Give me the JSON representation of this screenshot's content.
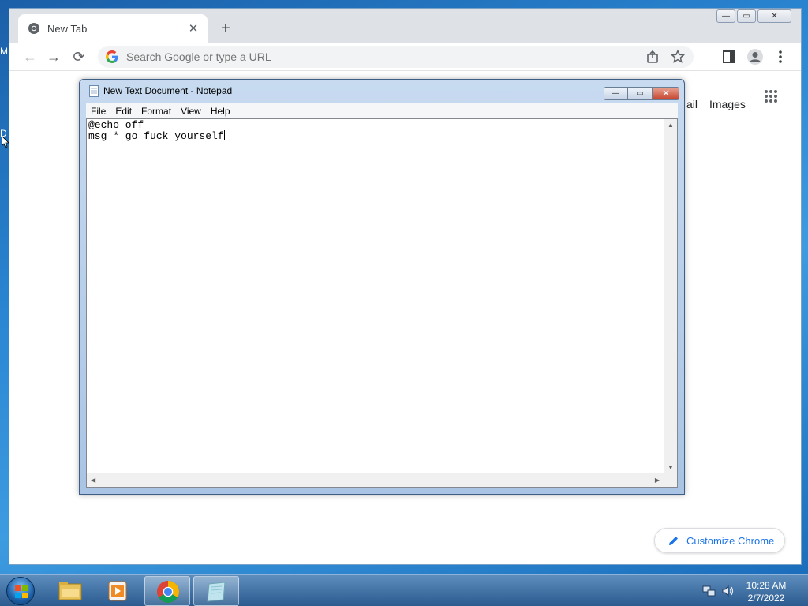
{
  "desktop": {
    "edge_glyph_top": "M",
    "edge_glyph_mid": "D"
  },
  "chrome": {
    "tab": {
      "title": "New Tab",
      "close_glyph": "✕"
    },
    "new_tab_glyph": "+",
    "caption": {
      "minimize": "—",
      "maximize": "▭",
      "close": "✕"
    },
    "toolbar": {
      "back": "←",
      "forward": "→",
      "reload": "⟳"
    },
    "omnibox": {
      "placeholder": "Search Google or type a URL"
    },
    "ntp": {
      "gmail_partial": "ail",
      "images": "Images"
    },
    "customize_label": "Customize Chrome"
  },
  "notepad": {
    "title": "New Text Document - Notepad",
    "menu": [
      "File",
      "Edit",
      "Format",
      "View",
      "Help"
    ],
    "caption": {
      "minimize": "—",
      "maximize": "▭",
      "close": "✕"
    },
    "lines": [
      "@echo off",
      "msg * go fuck yourself"
    ]
  },
  "taskbar": {
    "clock_time": "10:28 AM",
    "clock_date": "2/7/2022"
  },
  "colors": {
    "chrome_tabstrip": "#dee1e6",
    "accent_blue": "#1a73e8",
    "taskbar": "#2b5b8f"
  }
}
